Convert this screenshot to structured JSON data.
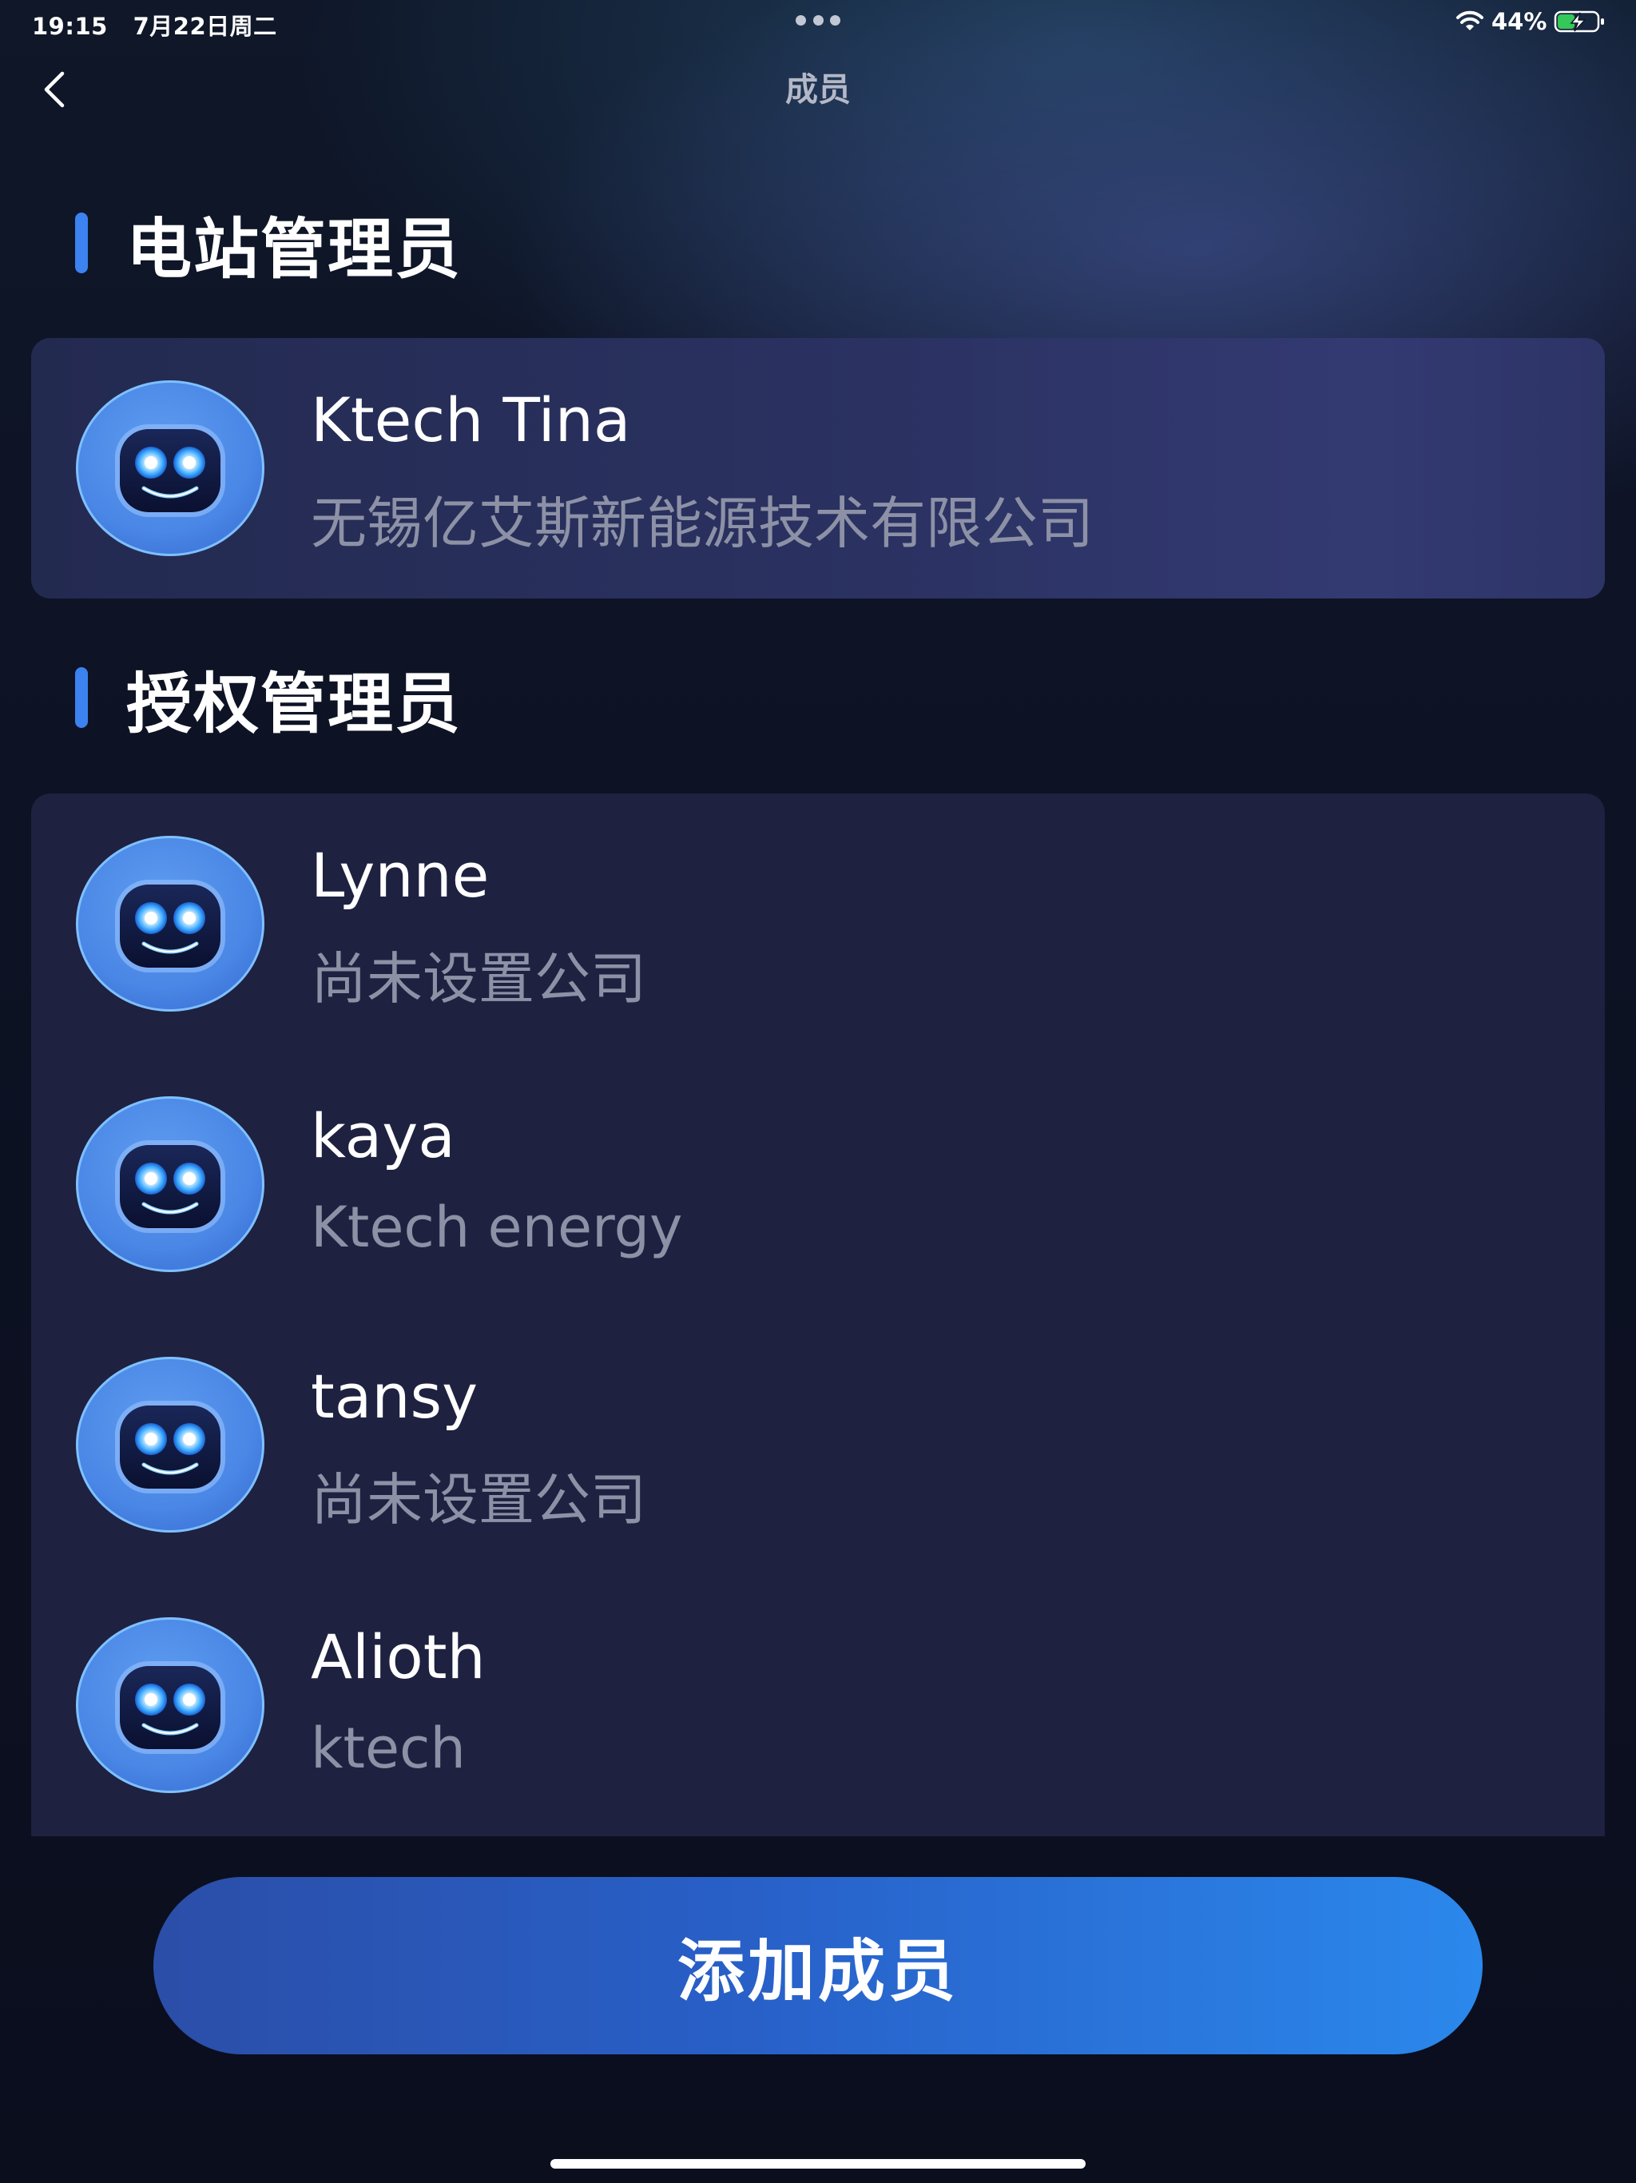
{
  "status_bar": {
    "time": "19:15",
    "date": "7月22日周二",
    "battery_percent": "44%",
    "battery_level": 0.44,
    "charging": true
  },
  "nav": {
    "title": "成员",
    "back_icon": "chevron-left-icon"
  },
  "station_admin_section": {
    "title": "电站管理员",
    "members": [
      {
        "name": "Ktech Tina",
        "company": "无锡亿艾斯新能源技术有限公司",
        "avatar_icon": "robot-avatar-icon"
      }
    ]
  },
  "authorized_admin_section": {
    "title": "授权管理员",
    "members": [
      {
        "name": "Lynne",
        "company": "尚未设置公司",
        "avatar_icon": "robot-avatar-icon"
      },
      {
        "name": "kaya",
        "company": "Ktech energy",
        "avatar_icon": "robot-avatar-icon"
      },
      {
        "name": "tansy",
        "company": "尚未设置公司",
        "avatar_icon": "robot-avatar-icon"
      },
      {
        "name": "Alioth",
        "company": "ktech",
        "avatar_icon": "robot-avatar-icon"
      }
    ]
  },
  "add_button": {
    "label": "添加成员"
  },
  "colors": {
    "accent": "#3c82f0",
    "avatar_blue": "#4a87e6",
    "button_start": "#2b4ea8",
    "button_end": "#2b88ec",
    "battery_green": "#34c759"
  }
}
